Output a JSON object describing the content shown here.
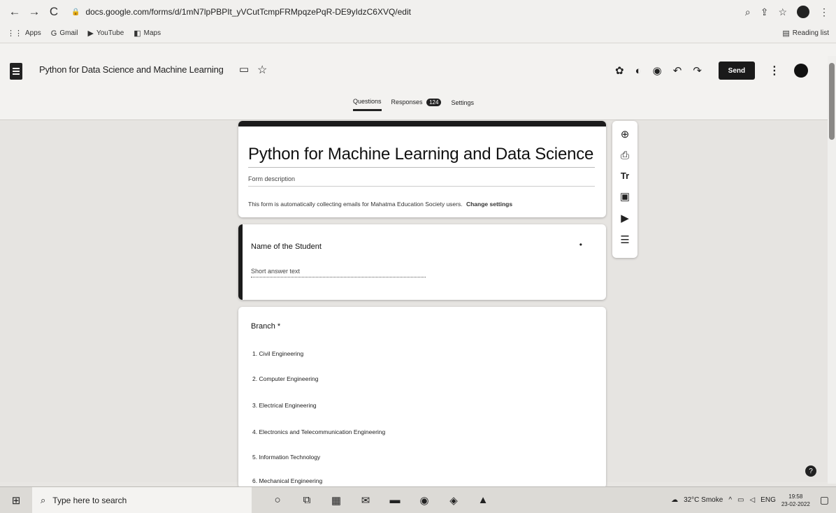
{
  "browser": {
    "url": "docs.google.com/forms/d/1mN7lpPBPIt_yVCutTcmpFRMpqzePqR-DE9yIdzC6XVQ/edit",
    "back_icon": "←",
    "forward_icon": "→",
    "reload_icon": "C",
    "bookmarks": [
      {
        "icon": "⋮⋮",
        "label": "Apps"
      },
      {
        "icon": "G",
        "label": "Gmail"
      },
      {
        "icon": "▶",
        "label": "YouTube"
      },
      {
        "icon": "◧",
        "label": "Maps"
      }
    ],
    "reading_list": "Reading list"
  },
  "header": {
    "doc_title": "Python for Data Science and Machine Learning",
    "send_label": "Send",
    "tabs": [
      {
        "label": "Questions",
        "active": true
      },
      {
        "label": "Responses",
        "badge": "124"
      },
      {
        "label": "Settings"
      }
    ]
  },
  "form": {
    "title": "Python for Machine Learning and Data Science",
    "description_placeholder": "Form description",
    "email_note": "This form is automatically collecting emails for Mahatma Education Society users.",
    "change_settings": "Change settings",
    "questions": [
      {
        "label": "Name of the Student",
        "answer_hint": "Short answer text"
      },
      {
        "label": "Branch *",
        "options": [
          "1.  Civil Engineering",
          "2.  Computer Engineering",
          "3.  Electrical Engineering",
          "4.  Electronics and Telecommunication Engineering",
          "5.  Information Technology",
          "6.  Mechanical Engineering"
        ]
      }
    ]
  },
  "taskbar": {
    "search_placeholder": "Type here to search",
    "weather": "32°C Smoke",
    "lang": "ENG",
    "time": "19:58",
    "date": "23-02-2022"
  }
}
